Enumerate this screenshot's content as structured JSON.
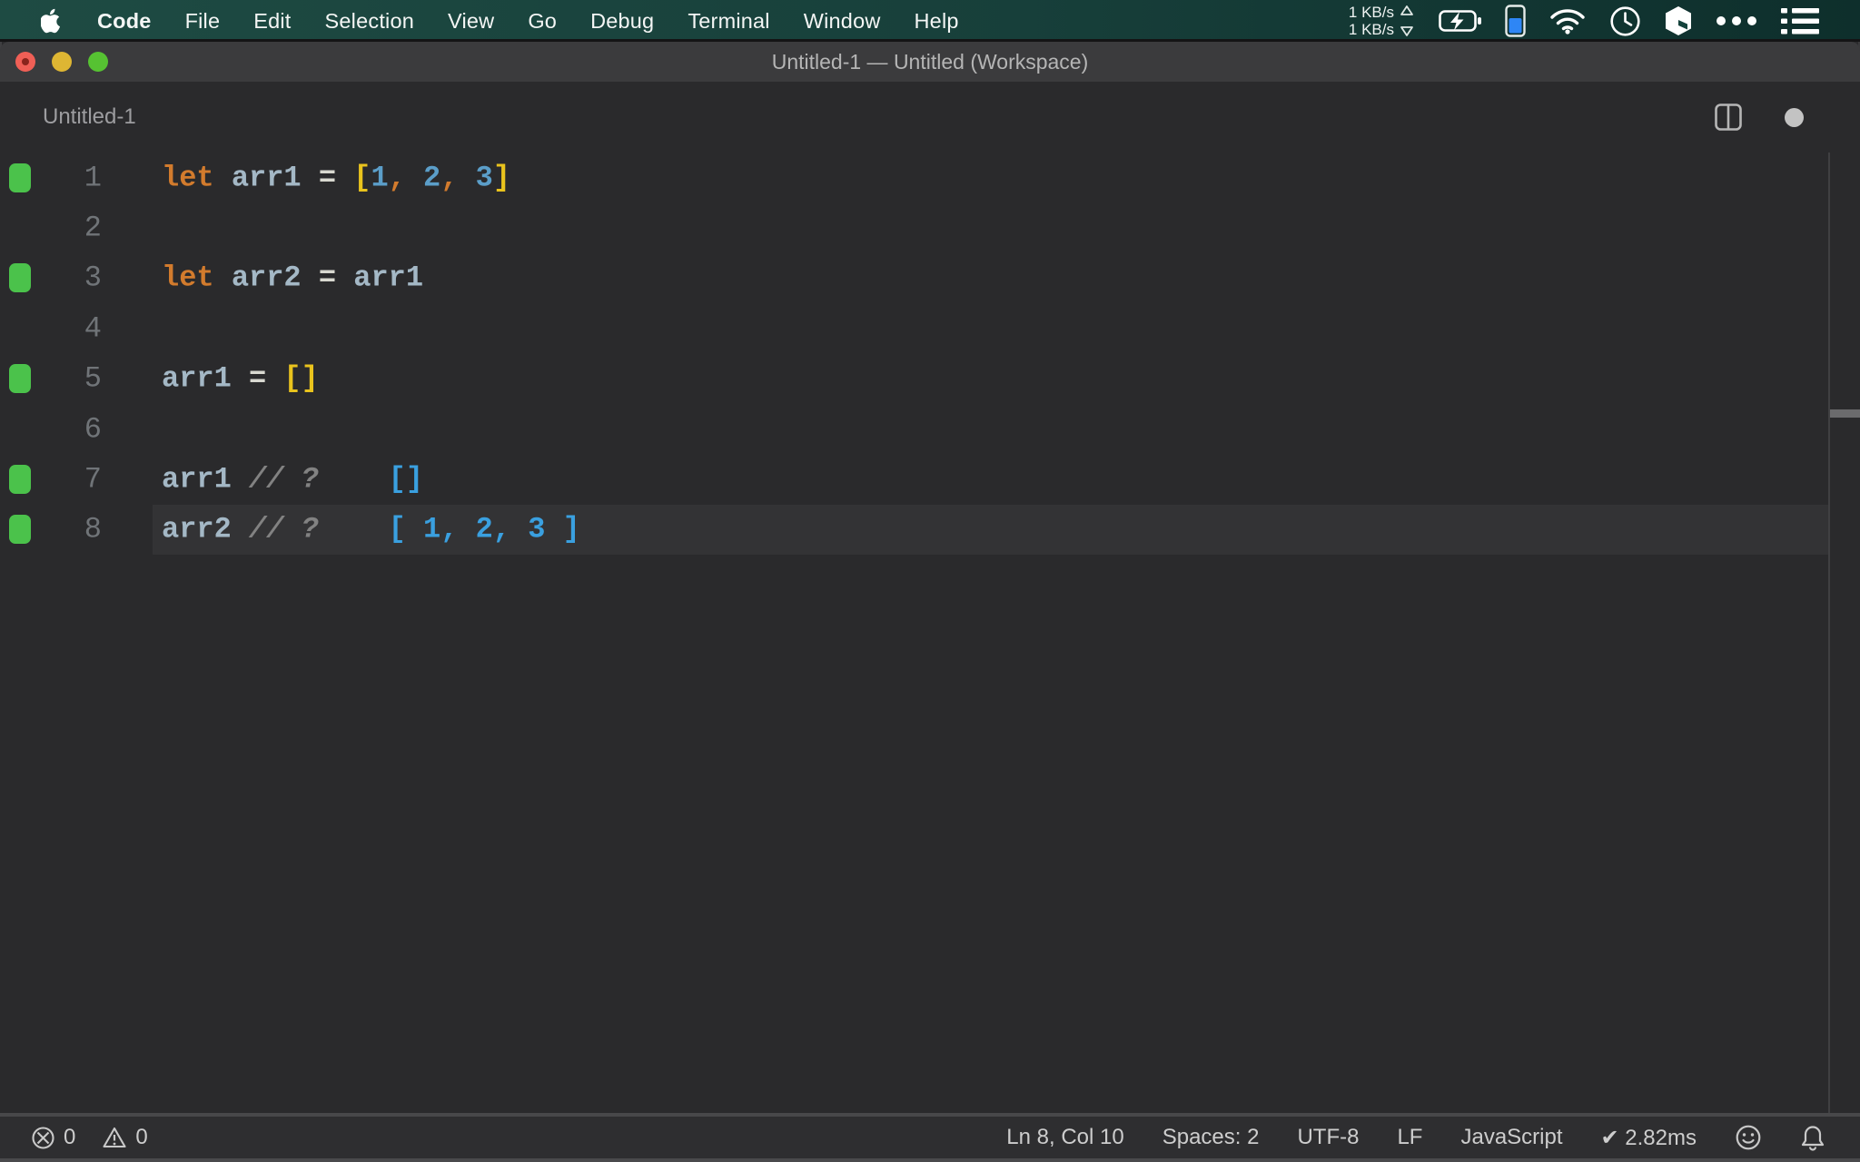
{
  "menubar": {
    "items": [
      {
        "label": "Code",
        "bold": true
      },
      {
        "label": "File"
      },
      {
        "label": "Edit"
      },
      {
        "label": "Selection"
      },
      {
        "label": "View"
      },
      {
        "label": "Go"
      },
      {
        "label": "Debug"
      },
      {
        "label": "Terminal"
      },
      {
        "label": "Window"
      },
      {
        "label": "Help"
      }
    ],
    "network": {
      "up": "1 KB/s",
      "down": "1 KB/s"
    },
    "status_icons": [
      "network-speed",
      "battery-charging",
      "battery-level",
      "wifi",
      "clock",
      "cube",
      "overflow-dots",
      "list"
    ]
  },
  "window": {
    "title": "Untitled-1 — Untitled (Workspace)"
  },
  "editor_header": {
    "tab_title": "Untitled-1",
    "action_icons": [
      "split-editor",
      "unsaved-dot"
    ]
  },
  "editor": {
    "language": "javascript",
    "lines": [
      {
        "n": "1",
        "mark": true,
        "current": false,
        "tokens": [
          [
            "let",
            "kw"
          ],
          [
            " ",
            ""
          ],
          [
            "arr1",
            "id"
          ],
          [
            " ",
            ""
          ],
          [
            "=",
            "op"
          ],
          [
            " ",
            ""
          ],
          [
            "[",
            "br"
          ],
          [
            "1",
            "num"
          ],
          [
            ",",
            "cm"
          ],
          [
            " ",
            ""
          ],
          [
            "2",
            "num"
          ],
          [
            ",",
            "cm"
          ],
          [
            " ",
            ""
          ],
          [
            "3",
            "num"
          ],
          [
            "]",
            "br"
          ]
        ]
      },
      {
        "n": "2",
        "mark": false,
        "current": false,
        "tokens": []
      },
      {
        "n": "3",
        "mark": true,
        "current": false,
        "tokens": [
          [
            "let",
            "kw"
          ],
          [
            " ",
            ""
          ],
          [
            "arr2",
            "id"
          ],
          [
            " ",
            ""
          ],
          [
            "=",
            "op"
          ],
          [
            " ",
            ""
          ],
          [
            "arr1",
            "id"
          ]
        ]
      },
      {
        "n": "4",
        "mark": false,
        "current": false,
        "tokens": []
      },
      {
        "n": "5",
        "mark": true,
        "current": false,
        "tokens": [
          [
            "arr1",
            "id"
          ],
          [
            " ",
            ""
          ],
          [
            "=",
            "op"
          ],
          [
            " ",
            ""
          ],
          [
            "[]",
            "br"
          ]
        ]
      },
      {
        "n": "6",
        "mark": false,
        "current": false,
        "tokens": []
      },
      {
        "n": "7",
        "mark": true,
        "current": false,
        "tokens": [
          [
            "arr1",
            "id"
          ],
          [
            " ",
            ""
          ],
          [
            "// ?",
            "cmt"
          ],
          [
            "    ",
            ""
          ],
          [
            "[]",
            "res"
          ]
        ]
      },
      {
        "n": "8",
        "mark": true,
        "current": true,
        "tokens": [
          [
            "arr2",
            "id"
          ],
          [
            " ",
            ""
          ],
          [
            "// ?",
            "cmt"
          ],
          [
            "    ",
            ""
          ],
          [
            "[ 1, 2, 3 ]",
            "res"
          ]
        ]
      }
    ]
  },
  "status_bar": {
    "errors": "0",
    "warnings": "0",
    "right_items": [
      {
        "name": "cursor-position",
        "label": "Ln 8, Col 10"
      },
      {
        "name": "indentation",
        "label": "Spaces: 2"
      },
      {
        "name": "encoding",
        "label": "UTF-8"
      },
      {
        "name": "eol-sequence",
        "label": "LF"
      },
      {
        "name": "language-mode",
        "label": "JavaScript"
      },
      {
        "name": "quokka-run-time",
        "label": "✔ 2.82ms"
      }
    ]
  },
  "colors": {
    "menubar_teal": "#1b4640",
    "keyword": "#d27b2d",
    "identifier": "#a4b8c6",
    "operator": "#d8d8d0",
    "bracket": "#e9c31d",
    "number": "#5b9ec9",
    "comment": "#828282",
    "quokka_value": "#3aa0e0",
    "coverage_green": "#4bc24b",
    "battery_blue": "#2e86f5",
    "traffic_red": "#f05f56",
    "traffic_yellow": "#deb633",
    "traffic_green": "#56c232"
  }
}
